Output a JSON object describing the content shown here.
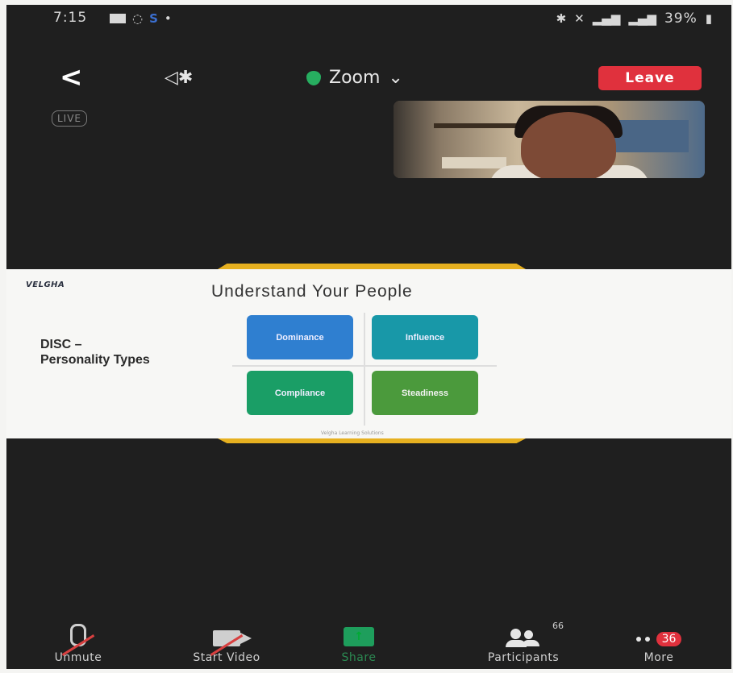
{
  "status_bar": {
    "time": "7:15",
    "battery": "39%"
  },
  "meeting": {
    "title": "Zoom",
    "leave_label": "Leave",
    "live_label": "LIVE"
  },
  "slide": {
    "logo": "VELGHA",
    "title": "Understand Your People",
    "side_label": "DISC – Personality Types",
    "quadrants": [
      "Dominance",
      "Influence",
      "Compliance",
      "Steadiness"
    ],
    "footer": "Velgha Learning Solutions"
  },
  "toolbar": {
    "unmute": "Unmute",
    "start_video": "Start Video",
    "share": "Share",
    "participants": "Participants",
    "participants_count": "66",
    "more": "More",
    "more_badge": "36"
  },
  "colors": {
    "leave": "#e0313d",
    "shield": "#27ae60",
    "dominance": "#2f7fd0",
    "influence": "#1898a8",
    "compliance": "#1a9e66",
    "steadiness": "#4b9a3c",
    "slide_accent": "#e6b020"
  }
}
